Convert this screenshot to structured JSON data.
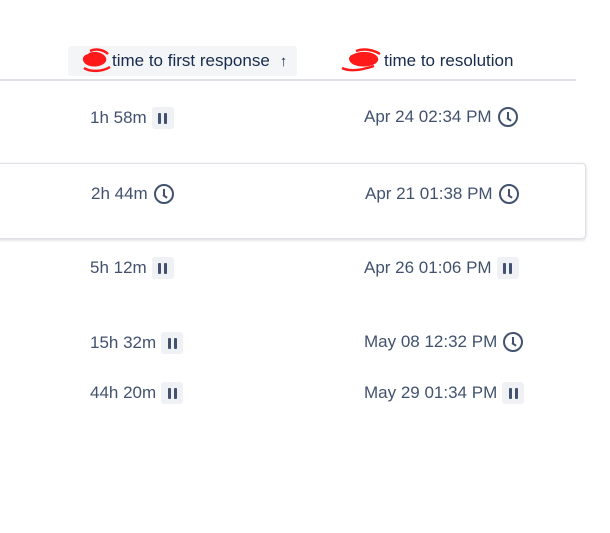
{
  "header": {
    "col1": {
      "label": "time to first response",
      "sort_arrow": "↑",
      "sort_direction": "ascending"
    },
    "col2": {
      "label": "time to resolution"
    }
  },
  "rows": [
    {
      "first_response": "1h 58m",
      "first_response_icon": "pause-icon",
      "resolution": "Apr 24 02:34 PM",
      "resolution_icon": "clock-icon"
    },
    {
      "first_response": "2h 44m",
      "first_response_icon": "clock-icon",
      "resolution": "Apr 21 01:38 PM",
      "resolution_icon": "clock-icon",
      "selected": true
    },
    {
      "first_response": "5h 12m",
      "first_response_icon": "pause-icon",
      "resolution": "Apr 26 01:06 PM",
      "resolution_icon": "pause-icon"
    },
    {
      "first_response": "15h 32m",
      "first_response_icon": "pause-icon",
      "resolution": "May 08 12:32 PM",
      "resolution_icon": "clock-icon"
    },
    {
      "first_response": "44h 20m",
      "first_response_icon": "pause-icon",
      "resolution": "May 29 01:34 PM",
      "resolution_icon": "pause-icon"
    }
  ],
  "colors": {
    "text": "#42526e",
    "header_text": "#172b4d",
    "divider": "#dfe1e6",
    "redaction": "#ff0000"
  }
}
